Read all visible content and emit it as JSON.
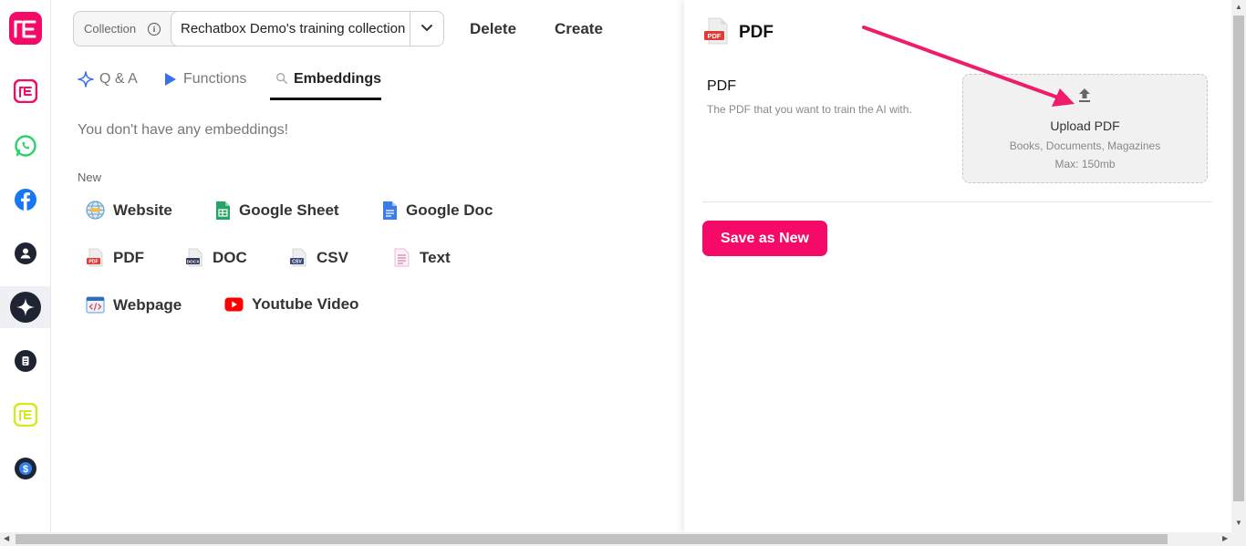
{
  "colors": {
    "brand": "#f50a67",
    "active_tab_underline": "#111111",
    "whatsapp": "#25d366",
    "facebook": "#1877f2",
    "dark_icon": "#1f2433",
    "yellow_logo": "#d7e81c"
  },
  "sidebar": {
    "items": [
      {
        "icon": "rechatbox-logo-icon"
      },
      {
        "icon": "rechatbox-pink-icon"
      },
      {
        "icon": "whatsapp-icon"
      },
      {
        "icon": "facebook-icon"
      },
      {
        "icon": "contact-icon"
      },
      {
        "icon": "ai-sparkle-icon",
        "active": true
      },
      {
        "icon": "notes-icon"
      },
      {
        "icon": "rechatbox-yellow-icon"
      },
      {
        "icon": "dollar-icon"
      }
    ]
  },
  "header": {
    "collection_label": "Collection",
    "collection_value": "Rechatbox Demo's training collection",
    "delete_label": "Delete",
    "create_label": "Create"
  },
  "tabs": [
    {
      "label": "Q & A",
      "icon": "sparkle-icon",
      "active": false
    },
    {
      "label": "Functions",
      "icon": "play-icon",
      "active": false
    },
    {
      "label": "Embeddings",
      "icon": "search-icon",
      "active": true
    }
  ],
  "embeddings": {
    "empty_message": "You don't have any embeddings!",
    "new_label": "New",
    "sources": [
      {
        "label": "Website",
        "icon": "globe-icon"
      },
      {
        "label": "Google Sheet",
        "icon": "google-sheet-icon"
      },
      {
        "label": "Google Doc",
        "icon": "google-doc-icon"
      },
      {
        "label": "PDF",
        "icon": "pdf-file-icon"
      },
      {
        "label": "DOC",
        "icon": "doc-file-icon"
      },
      {
        "label": "CSV",
        "icon": "csv-file-icon"
      },
      {
        "label": "Text",
        "icon": "text-file-icon"
      },
      {
        "label": "Webpage",
        "icon": "webpage-icon"
      },
      {
        "label": "Youtube Video",
        "icon": "youtube-icon"
      }
    ]
  },
  "panel": {
    "title": "PDF",
    "field_label": "PDF",
    "field_description": "The PDF that you want to train the AI with.",
    "upload": {
      "title": "Upload PDF",
      "subtitle": "Books, Documents, Magazines",
      "max_size": "Max: 150mb"
    },
    "save_label": "Save as New"
  }
}
